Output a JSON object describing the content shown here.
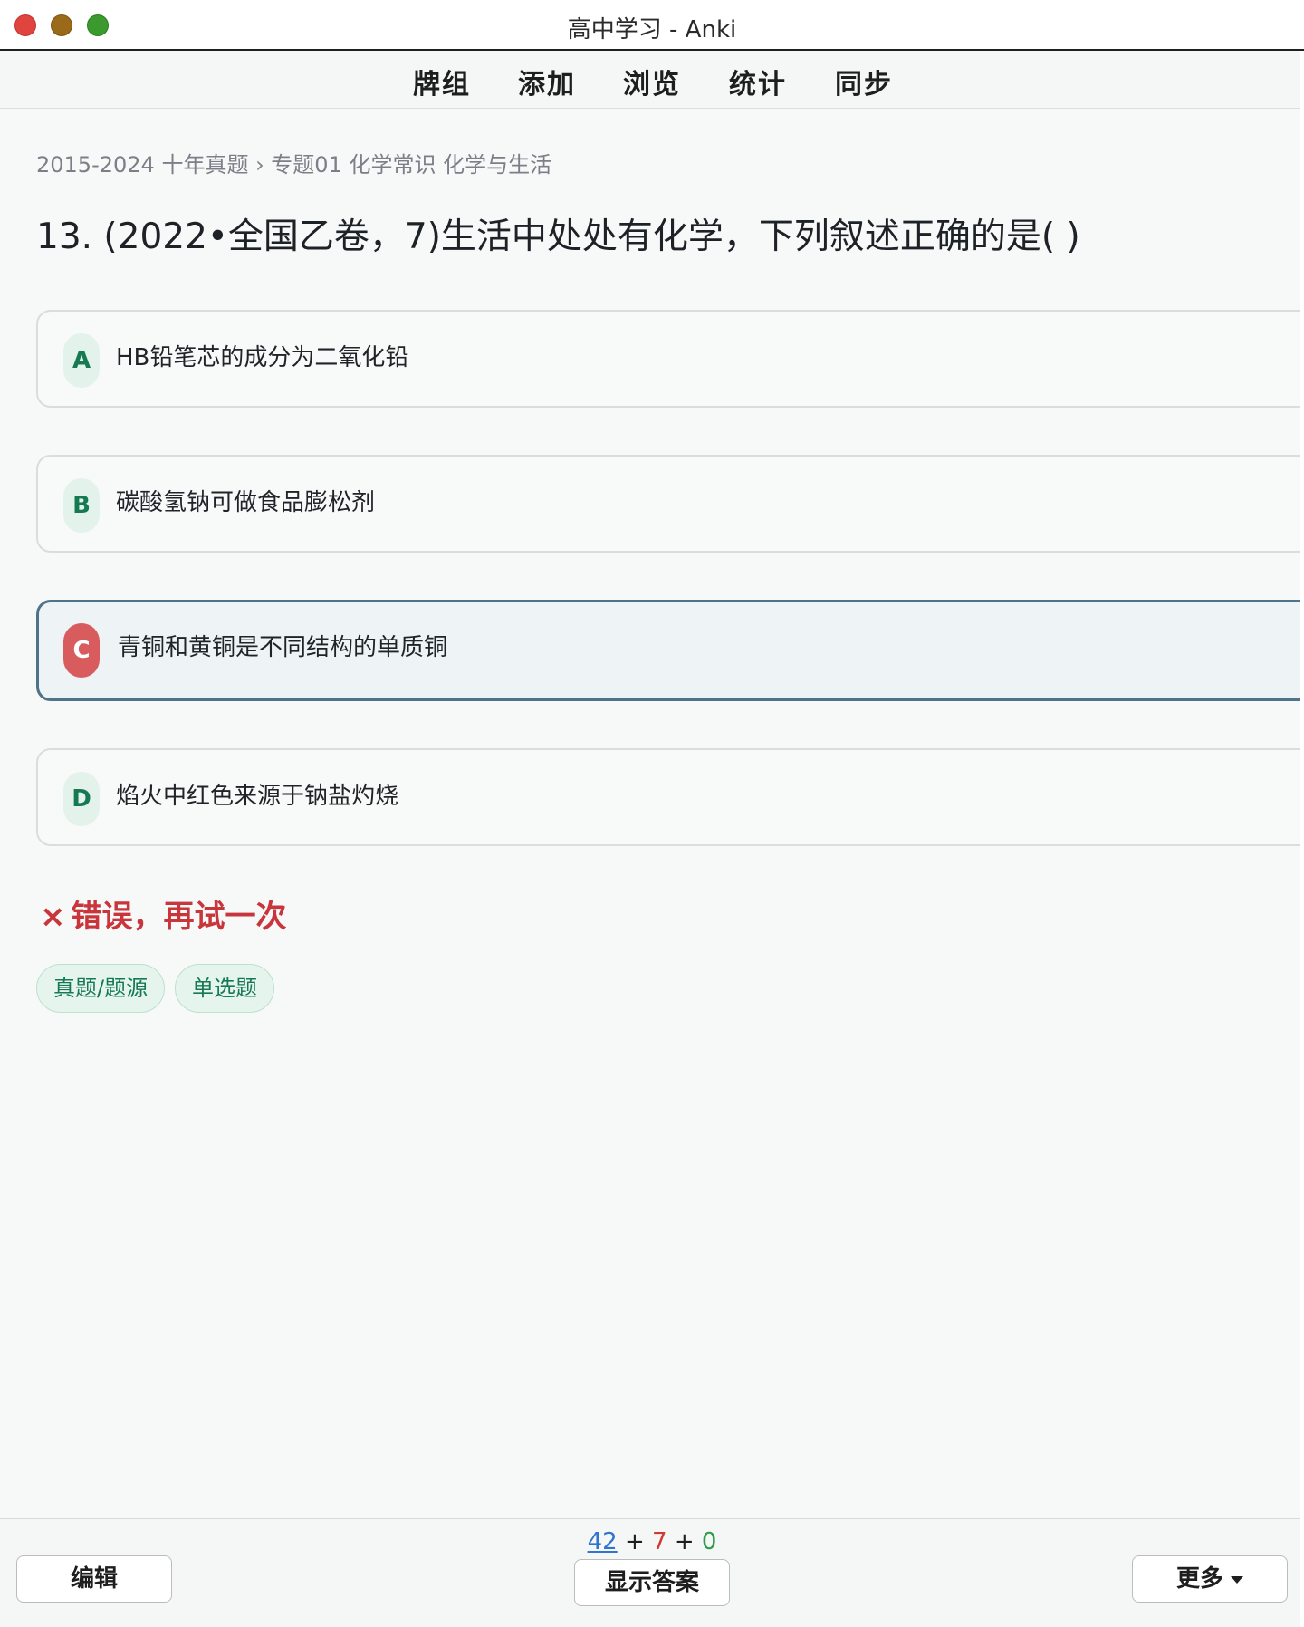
{
  "window": {
    "title": "高中学习 - Anki"
  },
  "toolbar": {
    "items": [
      "牌组",
      "添加",
      "浏览",
      "统计",
      "同步"
    ]
  },
  "breadcrumb": "2015-2024 十年真题 › 专题01 化学常识 化学与生活",
  "question": "13.  (2022•全国乙卷，7)生活中处处有化学，下列叙述正确的是( )",
  "options": [
    {
      "letter": "A",
      "text": "HB铅笔芯的成分为二氧化铅",
      "selected": false
    },
    {
      "letter": "B",
      "text": "碳酸氢钠可做食品膨松剂",
      "selected": false
    },
    {
      "letter": "C",
      "text": "青铜和黄铜是不同结构的单质铜",
      "selected": true
    },
    {
      "letter": "D",
      "text": "焰火中红色来源于钠盐灼烧",
      "selected": false
    }
  ],
  "feedback": {
    "icon": "×",
    "text": "错误，再试一次",
    "color": "#c8353b"
  },
  "tags": [
    "真题/题源",
    "单选题"
  ],
  "bottombar": {
    "edit_label": "编辑",
    "show_answer_label": "显示答案",
    "more_label": "更多",
    "counts": {
      "new": "42",
      "learn": "7",
      "review": "0",
      "sep": "+"
    }
  },
  "colors": {
    "accent_green": "#157a52",
    "selected_border": "#4f7488",
    "selected_badge": "#d85b5e",
    "new_count": "#2f74d0",
    "learn_count": "#d13a32",
    "review_count": "#2e9d4a"
  }
}
